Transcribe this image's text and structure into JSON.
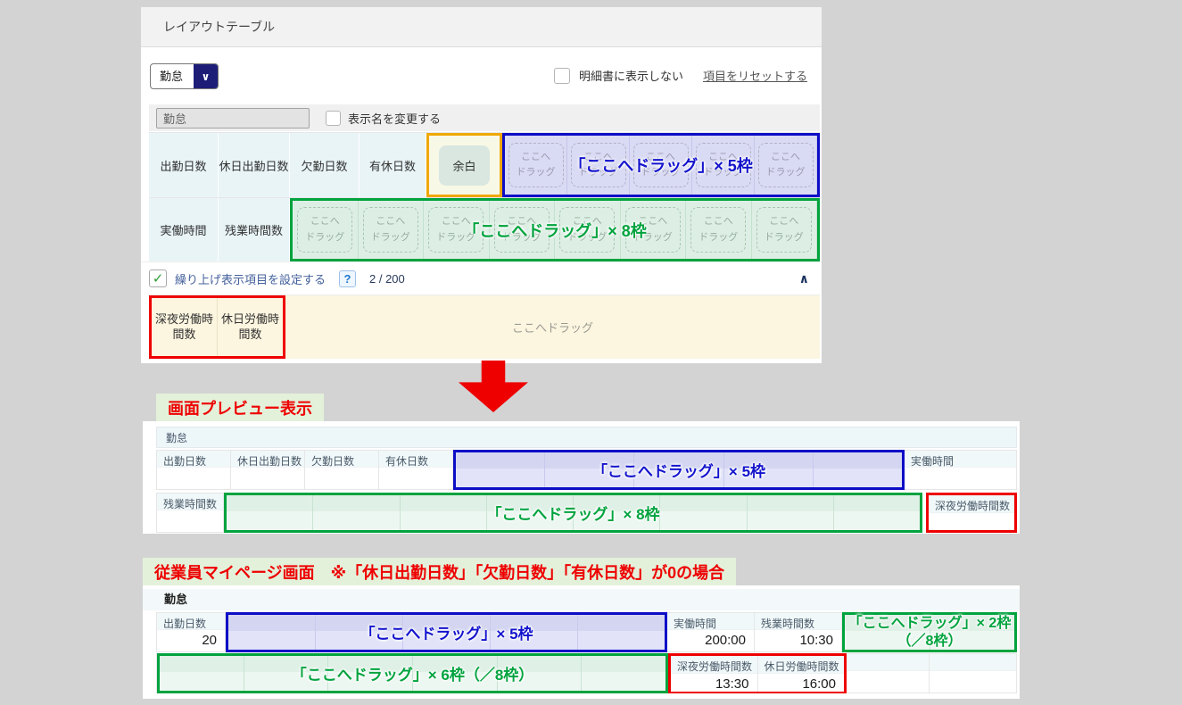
{
  "colors": {
    "page_bg": "#d3d3d3",
    "accent_blue": "#1313cd",
    "accent_green": "#00a33e",
    "accent_red": "#ee0000",
    "accent_orange": "#f0a700",
    "select_button_navy": "#1d1d78"
  },
  "icons": {
    "select_chevron": "∨",
    "collapse_chevron": "∧",
    "checkbox_check": "✓",
    "help": "?"
  },
  "top_panel": {
    "title": "レイアウトテーブル",
    "category_select_value": "勤怠",
    "hide_on_statement_label": "明細書に表示しない",
    "reset_items_link": "項目をリセットする",
    "display_name_value": "勤怠",
    "change_display_name_label": "表示名を変更する",
    "row1_items": [
      "出勤日数",
      "休日出勤日数",
      "欠勤日数",
      "有休日数"
    ],
    "blank_item": "余白",
    "drag_line1": "ここへ",
    "drag_line2": "ドラッグ",
    "blue_annotation": "「ここへドラッグ」× 5枠",
    "row2_items": [
      "実働時間",
      "残業時間数"
    ],
    "green_annotation": "「ここへドラッグ」× 8枠",
    "rollup_label": "繰り上げ表示項目を設定する",
    "rollup_count": "2 / 200",
    "overflow_items": [
      "深夜労働時間数",
      "休日労働時間数"
    ],
    "drop_area_text": "ここへドラッグ"
  },
  "preview": {
    "section_label": "画面プレビュー表示",
    "header": "勤怠",
    "row1_labels": [
      "出勤日数",
      "休日出勤日数",
      "欠勤日数",
      "有休日数"
    ],
    "blue_annotation": "「ここへドラッグ」× 5枠",
    "row1_tail": "実働時間",
    "row2_label": "残業時間数",
    "green_annotation": "「ここへドラッグ」× 8枠",
    "row2_tail": "深夜労働時間数"
  },
  "mypage": {
    "section_label": "従業員マイページ画面　※「休日出勤日数」「欠勤日数」「有休日数」が0の場合",
    "header": "勤怠",
    "col_shukkin": {
      "label": "出勤日数",
      "value": "20"
    },
    "blue_annotation": "「ここへドラッグ」× 5枠",
    "col_jitsudo": {
      "label": "実働時間",
      "value": "200:00"
    },
    "col_zangyo": {
      "label": "残業時間数",
      "value": "10:30"
    },
    "green2_line1": "「ここへドラッグ」× 2枠",
    "green2_line2": "（／8枠）",
    "green6_annotation": "「ここへドラッグ」× 6枠（／8枠）",
    "col_shinya": {
      "label": "深夜労働時間数",
      "value": "13:30"
    },
    "col_kyujitsu": {
      "label": "休日労働時間数",
      "value": "16:00"
    }
  }
}
